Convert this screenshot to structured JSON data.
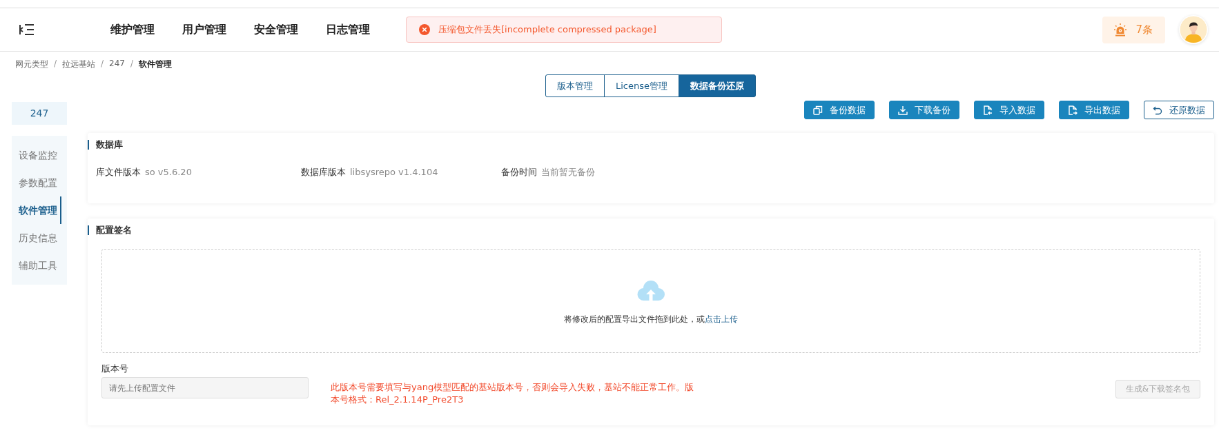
{
  "header": {
    "nav": [
      {
        "label": "维护管理"
      },
      {
        "label": "用户管理"
      },
      {
        "label": "安全管理"
      },
      {
        "label": "日志管理"
      }
    ],
    "toast": {
      "message": "压缩包文件丢失[incomplete compressed package]"
    },
    "alarm": {
      "count": "7条"
    }
  },
  "breadcrumb": [
    {
      "kind": "item",
      "label": "网元类型",
      "current": false
    },
    {
      "kind": "separator",
      "label": "/"
    },
    {
      "kind": "item",
      "label": "拉远基站",
      "current": false
    },
    {
      "kind": "separator",
      "label": "/"
    },
    {
      "kind": "item",
      "label": "247",
      "current": false
    },
    {
      "kind": "separator",
      "label": "/"
    },
    {
      "kind": "item",
      "label": "软件管理",
      "current": true
    }
  ],
  "tabs": [
    {
      "label": "版本管理",
      "selected": false
    },
    {
      "label": "License管理",
      "selected": false
    },
    {
      "label": "数据备份还原",
      "selected": true
    }
  ],
  "sidebar": {
    "node": "247",
    "items": [
      {
        "label": "设备监控",
        "selected": false
      },
      {
        "label": "参数配置",
        "selected": false
      },
      {
        "label": "软件管理",
        "selected": true
      },
      {
        "label": "历史信息",
        "selected": false
      },
      {
        "label": "辅助工具",
        "selected": false
      }
    ]
  },
  "actions": [
    {
      "label": "备份数据",
      "kind": "primary"
    },
    {
      "label": "下载备份",
      "kind": "primary"
    },
    {
      "label": "导入数据",
      "kind": "primary"
    },
    {
      "label": "导出数据",
      "kind": "primary"
    },
    {
      "label": "还原数据",
      "kind": "outline"
    }
  ],
  "database": {
    "title": "数据库",
    "fields": [
      {
        "label": "库文件版本",
        "value": "so v5.6.20"
      },
      {
        "label": "数据库版本",
        "value": "libsysrepo v1.4.104"
      },
      {
        "label": "备份时间",
        "value": "当前暂无备份"
      }
    ]
  },
  "signature": {
    "title": "配置签名",
    "upload": {
      "hint": "将修改后的配置导出文件拖到此处，或",
      "link": "点击上传"
    },
    "version_label": "版本号",
    "version_field": {
      "placeholder": "请先上传配置文件",
      "disabled": true
    },
    "warning": "此版本号需要填写与yang模型匹配的基站版本号，否则会导入失败，基站不能正常工作。版本号格式：Rel_2.1.14P_Pre2T3",
    "generate_button": {
      "label": "生成&下载签名包",
      "disabled": true
    }
  }
}
